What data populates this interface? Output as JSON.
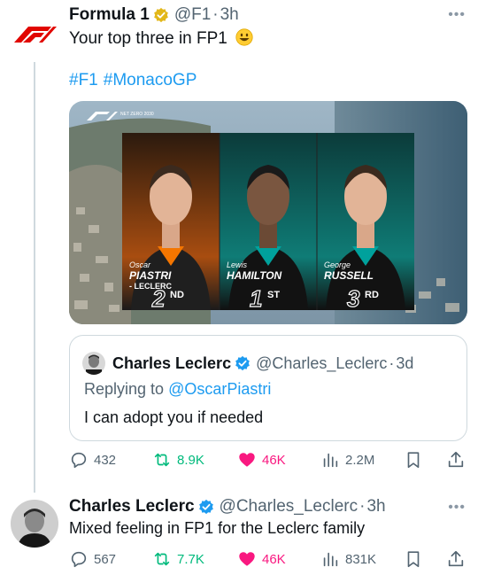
{
  "post1": {
    "author_name": "Formula 1",
    "handle": "@F1",
    "time": "3h",
    "text": "Your top three in FP1",
    "hashtags": [
      "#F1",
      "#MonacoGP"
    ],
    "media": {
      "logo_text": "NET ZERO 2030",
      "drivers": [
        {
          "first": "Oscar",
          "last": "PIASTRI",
          "extra": "- LECLERC",
          "position": "2",
          "suffix": "ND",
          "team_color": "#f47600"
        },
        {
          "first": "Lewis",
          "last": "HAMILTON",
          "position": "1",
          "suffix": "ST",
          "team_color": "#00a19c"
        },
        {
          "first": "George",
          "last": "RUSSELL",
          "position": "3",
          "suffix": "RD",
          "team_color": "#00a19c"
        }
      ]
    },
    "quote": {
      "author_name": "Charles Leclerc",
      "handle": "@Charles_Leclerc",
      "time": "3d",
      "reply_prefix": "Replying to",
      "reply_to": "@OscarPiastri",
      "text": "I can adopt you if needed"
    },
    "stats": {
      "replies": "432",
      "retweets": "8.9K",
      "likes": "46K",
      "views": "2.2M"
    }
  },
  "post2": {
    "author_name": "Charles Leclerc",
    "handle": "@Charles_Leclerc",
    "time": "3h",
    "text": "Mixed feeling in FP1 for the Leclerc family",
    "stats": {
      "replies": "567",
      "retweets": "7.7K",
      "likes": "46K",
      "views": "831K"
    }
  },
  "colors": {
    "accent": "#1d9bf0",
    "like": "#f91880",
    "retweet": "#00ba7c",
    "f1_red": "#e10600",
    "verified_gold": "#e2b719"
  }
}
